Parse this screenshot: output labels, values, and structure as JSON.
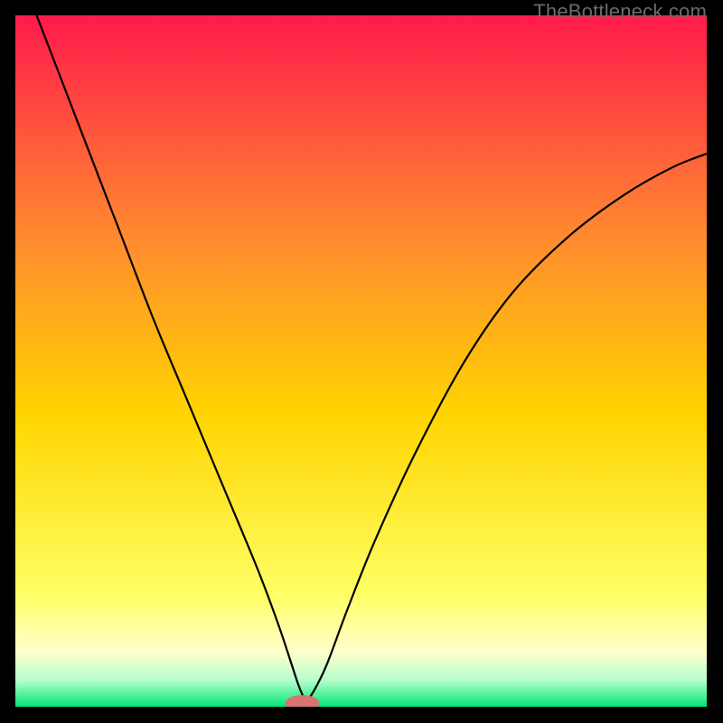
{
  "watermark": "TheBottleneck.com",
  "colors": {
    "gradient_top": "#ff1a4b",
    "gradient_mid_upper": "#ff8a2f",
    "gradient_mid": "#ffd500",
    "gradient_lower": "#ffff66",
    "gradient_pale": "#ffffcc",
    "gradient_green_pale": "#b3ffcc",
    "gradient_green": "#00e676",
    "curve": "#000000",
    "marker_fill": "#d8736f",
    "marker_stroke": "#d8736f",
    "frame": "#000000"
  },
  "chart_data": {
    "type": "line",
    "title": "",
    "xlabel": "",
    "ylabel": "",
    "xlim": [
      0,
      100
    ],
    "ylim": [
      0,
      100
    ],
    "series": [
      {
        "name": "bottleneck-curve",
        "x": [
          0,
          5,
          10,
          15,
          20,
          25,
          30,
          35,
          38,
          40,
          41,
          42,
          43,
          45,
          48,
          52,
          58,
          65,
          72,
          80,
          88,
          95,
          100
        ],
        "y": [
          108,
          95,
          82,
          69,
          56,
          44,
          32,
          20,
          12,
          6,
          3,
          1,
          2,
          6,
          14,
          24,
          37,
          50,
          60,
          68,
          74,
          78,
          80
        ]
      }
    ],
    "marker": {
      "x": 41.5,
      "y": 0.5,
      "rx": 2.4,
      "ry": 1.1
    },
    "annotations": []
  }
}
